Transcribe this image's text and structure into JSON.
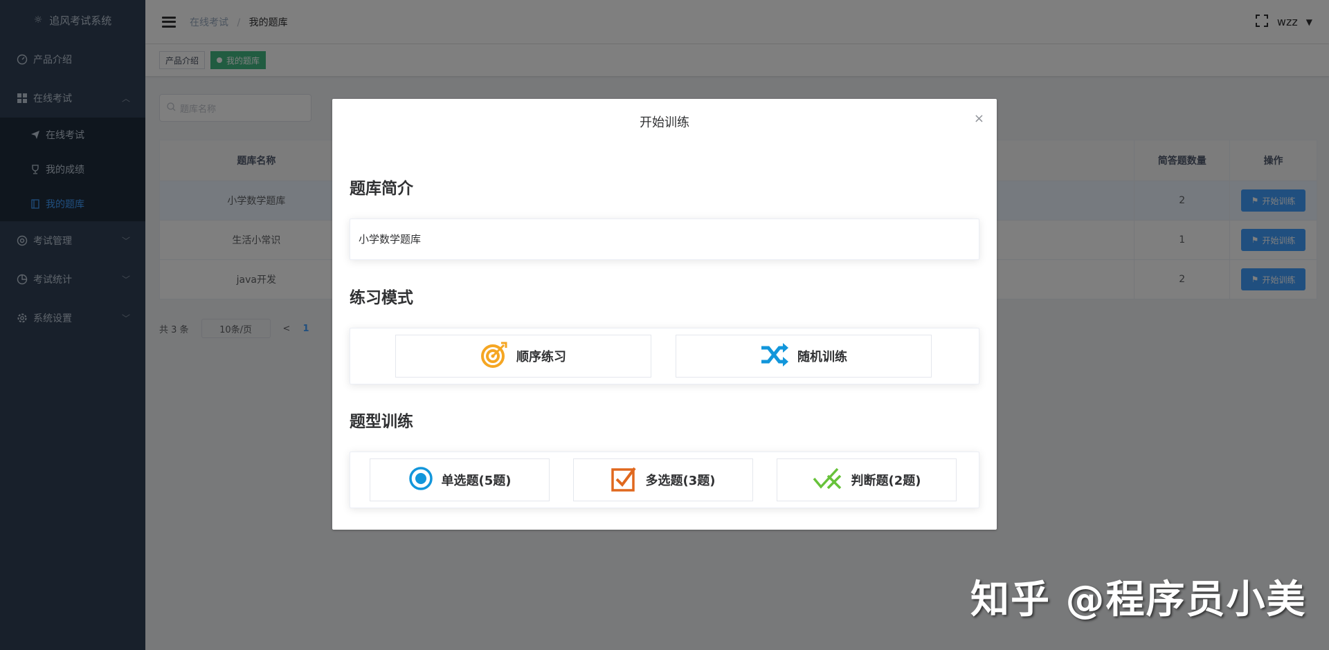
{
  "app": {
    "title": "追风考试系统"
  },
  "sidebar": {
    "items": [
      {
        "label": "产品介绍"
      },
      {
        "label": "在线考试"
      },
      {
        "label": "考试管理"
      },
      {
        "label": "考试统计"
      },
      {
        "label": "系统设置"
      }
    ],
    "sub_items": [
      {
        "label": "在线考试"
      },
      {
        "label": "我的成绩"
      },
      {
        "label": "我的题库"
      }
    ]
  },
  "header": {
    "breadcrumb": [
      "在线考试",
      "我的题库"
    ],
    "separator": "/",
    "user": "wzz"
  },
  "tags": [
    "产品介绍",
    "我的题库"
  ],
  "search": {
    "placeholder": "题库名称"
  },
  "table": {
    "columns": [
      "题库名称",
      "简答题数量",
      "操作"
    ],
    "rows": [
      {
        "name": "小学数学题库",
        "count": "2",
        "action": "开始训练"
      },
      {
        "name": "生活小常识",
        "count": "1",
        "action": "开始训练"
      },
      {
        "name": "java开发",
        "count": "2",
        "action": "开始训练"
      }
    ]
  },
  "pager": {
    "total": "共 3 条",
    "page_size": "10条/页",
    "prev": "<",
    "current": "1"
  },
  "dialog": {
    "title": "开始训练",
    "close": "×",
    "intro_title": "题库简介",
    "intro_text": "小学数学题库",
    "mode_title": "练习模式",
    "modes": [
      {
        "label": "顺序练习"
      },
      {
        "label": "随机训练"
      }
    ],
    "type_title": "题型训练",
    "types": [
      {
        "label": "单选题(5题)"
      },
      {
        "label": "多选题(3题)"
      },
      {
        "label": "判断题(2题)"
      }
    ]
  },
  "watermark": "知乎 @程序员小美",
  "colors": {
    "sidebar_bg": "#304156",
    "primary": "#409eff",
    "tag_active": "#42b983"
  }
}
